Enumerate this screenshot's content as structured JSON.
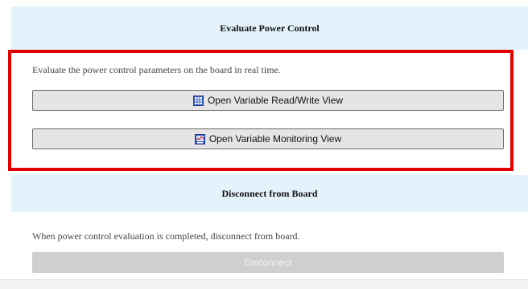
{
  "evaluate_section": {
    "title": "Evaluate Power Control",
    "description": "Evaluate the power control parameters on the board in real time.",
    "read_write_button": {
      "label": "Open Variable Read/Write View",
      "icon": "table-grid-icon"
    },
    "monitoring_button": {
      "label": "Open Variable Monitoring View",
      "icon": "monitor-chart-icon"
    }
  },
  "disconnect_section": {
    "title": "Disconnect from Board",
    "description": "When power control evaluation is completed, disconnect from board.",
    "disconnect_button": {
      "label": "Disconnect",
      "enabled": false
    }
  },
  "colors": {
    "section_header_bg": "#e3f2fb",
    "highlight_border": "#e00000",
    "button_bg": "#e5e5e5",
    "disabled_button_bg": "#cfcfcf"
  }
}
